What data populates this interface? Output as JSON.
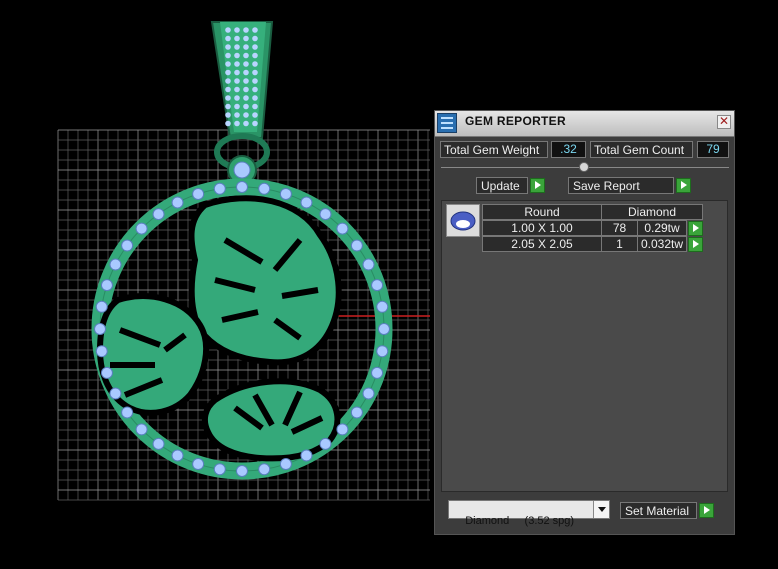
{
  "panel": {
    "title": "GEM REPORTER",
    "close_glyph": "✕",
    "total_gem_weight_label": "Total Gem Weight",
    "total_gem_weight_value": ".32",
    "total_gem_count_label": "Total Gem Count",
    "total_gem_count_value": "79",
    "update_label": "Update",
    "save_report_label": "Save Report",
    "table": {
      "header_shape": "Round",
      "header_material": "Diamond",
      "rows": [
        {
          "size": "1.00 X 1.00",
          "count": "78",
          "weight": "0.29tw"
        },
        {
          "size": "2.05 X 2.05",
          "count": "1",
          "weight": "0.032tw"
        }
      ]
    },
    "material_select_value": "Diamond     (3.52 spg)",
    "set_material_label": "Set Material"
  },
  "colors": {
    "metal": "#34a97a",
    "metal_dark": "#1f7a55",
    "gem": "#a9c9ff",
    "grid": "#8a8a8a",
    "background": "#000000",
    "axis_red": "#cc2020"
  },
  "icons": [
    "gem-reporter-icon",
    "close-icon",
    "play-icon",
    "gem-thumbnail-icon",
    "dropdown-arrow-icon"
  ]
}
